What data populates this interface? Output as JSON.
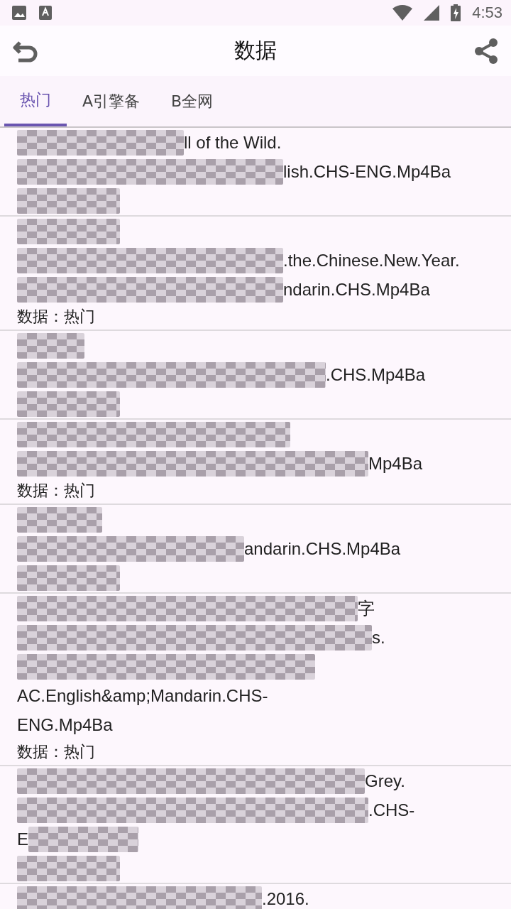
{
  "status_bar": {
    "time": "4:53"
  },
  "header": {
    "title": "数据"
  },
  "tabs": [
    {
      "label": "热门",
      "selected": true
    },
    {
      "label": "A引擎备",
      "selected": false
    },
    {
      "label": "B全网",
      "selected": false
    }
  ],
  "items": [
    {
      "lines": [
        {
          "kind": "masked",
          "text": "ll of the Wild."
        },
        {
          "kind": "masked",
          "text": "lish.CHS-ENG.Mp4Ba"
        },
        {
          "kind": "mask"
        }
      ]
    },
    {
      "lines": [
        {
          "kind": "mask"
        },
        {
          "kind": "masked",
          "text": ".the.Chinese.New.Year."
        },
        {
          "kind": "masked",
          "text": "ndarin.CHS.Mp4Ba"
        },
        {
          "kind": "source",
          "text": "数据：热门"
        }
      ]
    },
    {
      "lines": [
        {
          "kind": "mask"
        },
        {
          "kind": "masked",
          "text": ".CHS.Mp4Ba"
        },
        {
          "kind": "mask"
        }
      ]
    },
    {
      "lines": [
        {
          "kind": "mask"
        },
        {
          "kind": "masked",
          "text": "Mp4Ba"
        },
        {
          "kind": "source",
          "text": "数据：热门"
        }
      ]
    },
    {
      "lines": [
        {
          "kind": "mask"
        },
        {
          "kind": "masked",
          "text": "andarin.CHS.Mp4Ba"
        },
        {
          "kind": "mask"
        }
      ]
    },
    {
      "lines": [
        {
          "kind": "masked",
          "text": "字"
        },
        {
          "kind": "masked",
          "text": "s."
        },
        {
          "kind": "mask"
        },
        {
          "kind": "text",
          "text": "AC.English&amp;Mandarin.CHS-"
        },
        {
          "kind": "text",
          "text": "ENG.Mp4Ba"
        },
        {
          "kind": "source",
          "text": "数据：热门"
        }
      ]
    },
    {
      "lines": [
        {
          "kind": "masked",
          "text": "Grey."
        },
        {
          "kind": "masked",
          "text": ".CHS-"
        },
        {
          "kind": "trailing",
          "text": "E"
        },
        {
          "kind": "mask"
        }
      ]
    },
    {
      "lines": [
        {
          "kind": "masked",
          "text": ".2016."
        }
      ]
    }
  ]
}
